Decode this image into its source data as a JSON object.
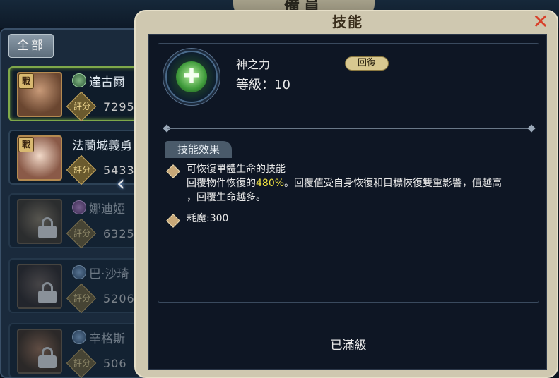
{
  "background": {
    "top_banner": "備員",
    "tab_all": "全部",
    "heroes": [
      {
        "class_badge": "戰",
        "name": "達古爾",
        "score_label": "評分",
        "score": "7295",
        "locked": false
      },
      {
        "class_badge": "戰",
        "name": "法蘭城義勇",
        "score_label": "評分",
        "score": "5433",
        "locked": false
      },
      {
        "class_badge": "",
        "name": "娜迪婭",
        "score_label": "評分",
        "score": "6325",
        "locked": true
      },
      {
        "class_badge": "",
        "name": "巴·沙琦",
        "score_label": "評分",
        "score": "5206",
        "locked": true
      },
      {
        "class_badge": "",
        "name": "辛格斯",
        "score_label": "評分",
        "score": "506",
        "locked": true
      }
    ]
  },
  "dialog": {
    "title": "技能",
    "skill": {
      "icon": "fist-heal-icon",
      "name": "神之力",
      "tag": "回復",
      "level_text": "等級：10"
    },
    "section_label": "技能效果",
    "effects": {
      "line1": "可恢復單體生命的技能",
      "line2_pre": "回覆物件恢復的",
      "line2_highlight": "480%",
      "line2_post": "。回覆值受自身恢復和目標恢復雙重影響，值越高",
      "line3": "，回覆生命越多。",
      "mana": "耗魔:300"
    },
    "status": "已滿級",
    "close_icon": "close-x-icon"
  },
  "colors": {
    "highlight": "#f0e040",
    "close": "#d8402a",
    "dialog_frame": "#cfc8b0",
    "dialog_body": "#0e1624"
  }
}
